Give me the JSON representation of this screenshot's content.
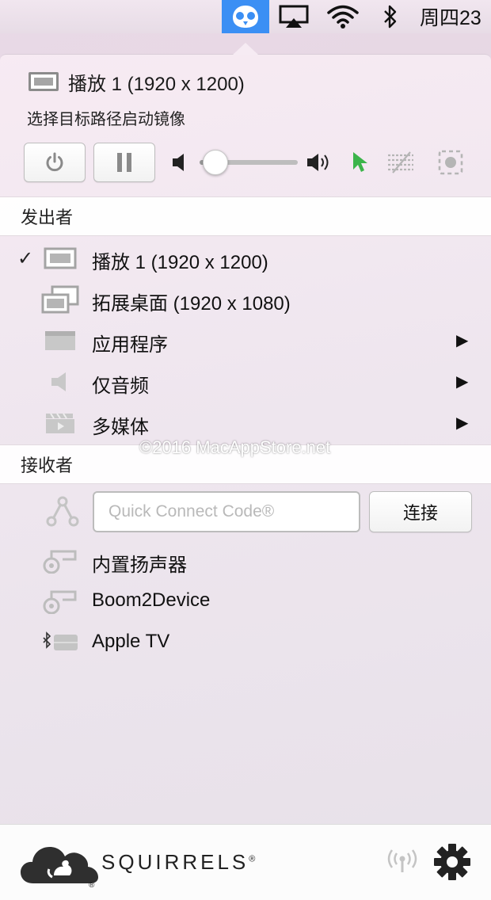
{
  "menubar": {
    "active_icon": "squirrels-icon",
    "items": [
      "airplay-icon",
      "wifi-icon",
      "bluetooth-icon"
    ],
    "clock": "周四23"
  },
  "source": {
    "title": "播放 1 (1920 x 1200)",
    "subtitle": "选择目标路径启动镜像"
  },
  "controls": {
    "volume_level": 0.16,
    "icons": [
      "power-icon",
      "pause-icon",
      "volume-low-icon",
      "volume-high-icon",
      "cursor-icon",
      "stripes-icon",
      "capture-icon"
    ],
    "cursor_color": "#3bb44a"
  },
  "sender": {
    "header": "发出者",
    "items": [
      {
        "label": "播放 1 (1920 x 1200)",
        "checked": true,
        "icon": "monitor-icon"
      },
      {
        "label": "拓展桌面 (1920 x 1080)",
        "checked": false,
        "icon": "extended-desktop-icon"
      },
      {
        "label": "应用程序",
        "checked": false,
        "icon": "app-window-icon",
        "submenu": "▶"
      },
      {
        "label": "仅音频",
        "checked": false,
        "icon": "speaker-icon",
        "submenu": "▶"
      },
      {
        "label": "多媒体",
        "checked": false,
        "icon": "clapperboard-icon",
        "submenu": "▶"
      }
    ]
  },
  "watermark": "©2016 MacAppStore.net",
  "receiver": {
    "header": "接收者",
    "code_placeholder": "Quick Connect Code®",
    "connect_label": "连接",
    "items": [
      {
        "label": "内置扬声器",
        "icon": "speaker-output-icon"
      },
      {
        "label": "Boom2Device",
        "icon": "speaker-output-icon"
      },
      {
        "label": "Apple TV",
        "icon": "apple-tv-bluetooth-icon"
      }
    ]
  },
  "footer": {
    "brand": "SQUIRRELS",
    "brand_mark": "®",
    "logo_mark": "®",
    "icons": [
      "broadcast-icon",
      "gear-icon"
    ]
  }
}
